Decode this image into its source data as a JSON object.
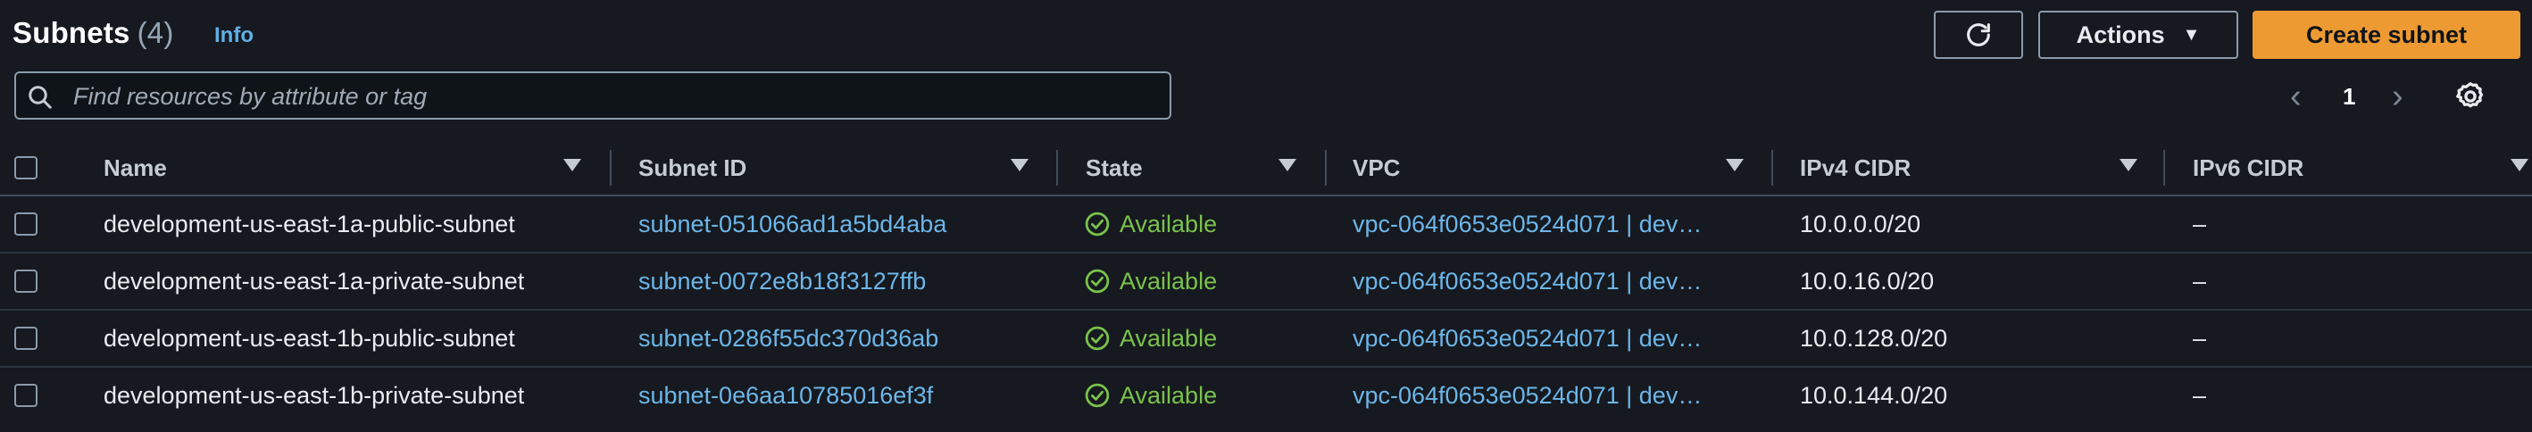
{
  "header": {
    "title": "Subnets",
    "count": "(4)",
    "info_label": "Info"
  },
  "toolbar": {
    "refresh_icon": "refresh-icon",
    "actions_label": "Actions",
    "create_label": "Create subnet"
  },
  "search": {
    "placeholder": "Find resources by attribute or tag",
    "value": ""
  },
  "pagination": {
    "current_page": "1"
  },
  "table": {
    "columns": [
      "Name",
      "Subnet ID",
      "State",
      "VPC",
      "IPv4 CIDR",
      "IPv6 CIDR"
    ],
    "rows": [
      {
        "name": "development-us-east-1a-public-subnet",
        "subnet_id": "subnet-051066ad1a5bd4aba",
        "state": "Available",
        "vpc": "vpc-064f0653e0524d071 | dev…",
        "ipv4": "10.0.0.0/20",
        "ipv6": "–"
      },
      {
        "name": "development-us-east-1a-private-subnet",
        "subnet_id": "subnet-0072e8b18f3127ffb",
        "state": "Available",
        "vpc": "vpc-064f0653e0524d071 | dev…",
        "ipv4": "10.0.16.0/20",
        "ipv6": "–"
      },
      {
        "name": "development-us-east-1b-public-subnet",
        "subnet_id": "subnet-0286f55dc370d36ab",
        "state": "Available",
        "vpc": "vpc-064f0653e0524d071 | dev…",
        "ipv4": "10.0.128.0/20",
        "ipv6": "–"
      },
      {
        "name": "development-us-east-1b-private-subnet",
        "subnet_id": "subnet-0e6aa10785016ef3f",
        "state": "Available",
        "vpc": "vpc-064f0653e0524d071 | dev…",
        "ipv4": "10.0.144.0/20",
        "ipv6": "–"
      }
    ]
  },
  "colors": {
    "background": "#16191f",
    "link": "#6cb6e9",
    "available": "#7ac24c",
    "primary_button": "#ee9a33"
  }
}
